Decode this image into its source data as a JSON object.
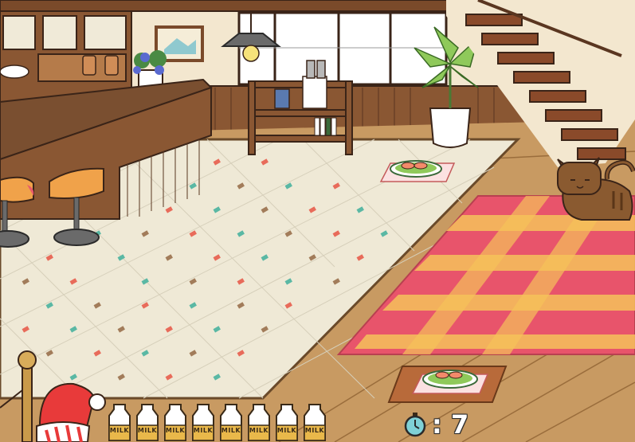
{
  "game": {
    "timer": {
      "icon": "stopwatch-icon",
      "value": ": 7"
    },
    "milk_bottles": {
      "count": 8,
      "label": "MILK",
      "items": [
        {
          "label": "MILK"
        },
        {
          "label": "MILK"
        },
        {
          "label": "MILK"
        },
        {
          "label": "MILK"
        },
        {
          "label": "MILK"
        },
        {
          "label": "MILK"
        },
        {
          "label": "MILK"
        },
        {
          "label": "MILK"
        }
      ]
    },
    "scene": {
      "room": "cafe interior",
      "items": [
        "food-plate-tile",
        "food-plate-rug",
        "cat-tabby",
        "santa-hat",
        "checkered-rug",
        "potted-palm",
        "bar-stools",
        "bookshelf",
        "pendant-lamp",
        "flower-pot",
        "staircase"
      ]
    },
    "colors": {
      "wood_floor": "#c89a62",
      "tile_floor": "#efe9d6",
      "rug_red": "#e8546b",
      "rug_yellow": "#f5c25a",
      "counter": "#7a4f30",
      "timer_icon": "#7fd1d6"
    }
  }
}
